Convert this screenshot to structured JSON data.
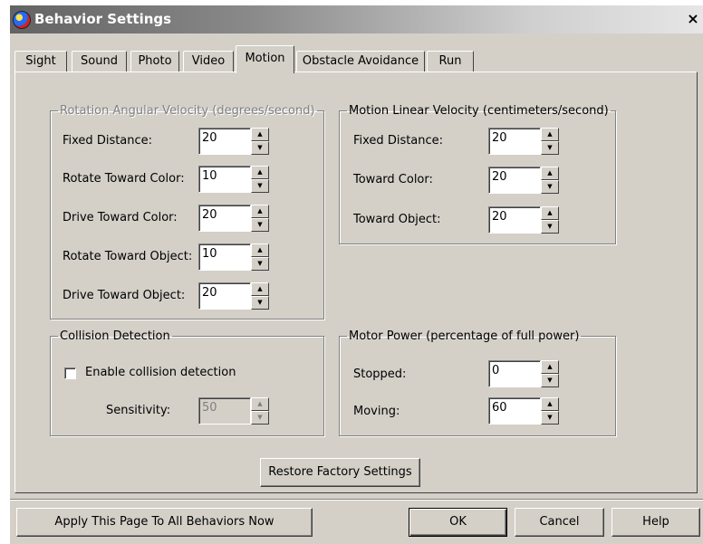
{
  "window": {
    "title": "Behavior Settings",
    "close_glyph": "×"
  },
  "tabs": [
    {
      "label": "Sight"
    },
    {
      "label": "Sound"
    },
    {
      "label": "Photo"
    },
    {
      "label": "Video"
    },
    {
      "label": "Motion",
      "active": true
    },
    {
      "label": "Obstacle Avoidance"
    },
    {
      "label": "Run"
    }
  ],
  "rotation_group": {
    "legend": "Rotation Angular Velocity (degrees/second)",
    "disabled": true,
    "fields": [
      {
        "label": "Fixed Distance:",
        "value": "20"
      },
      {
        "label": "Rotate Toward Color:",
        "value": "10"
      },
      {
        "label": "Drive Toward Color:",
        "value": "20"
      },
      {
        "label": "Rotate Toward Object:",
        "value": "10"
      },
      {
        "label": "Drive Toward Object:",
        "value": "20"
      }
    ]
  },
  "linear_group": {
    "legend": "Motion Linear Velocity (centimeters/second)",
    "fields": [
      {
        "label": "Fixed Distance:",
        "value": "20"
      },
      {
        "label": "Toward Color:",
        "value": "20"
      },
      {
        "label": "Toward Object:",
        "value": "20"
      }
    ]
  },
  "collision_group": {
    "legend": "Collision Detection",
    "checkbox_label": "Enable collision detection",
    "checked": false,
    "sensitivity_label": "Sensitivity:",
    "sensitivity_value": "50"
  },
  "motor_group": {
    "legend": "Motor Power (percentage of full power)",
    "fields": [
      {
        "label": "Stopped:",
        "value": "0"
      },
      {
        "label": "Moving:",
        "value": "60"
      }
    ]
  },
  "spinner_glyphs": {
    "up": "▲",
    "down": "▼"
  },
  "buttons": {
    "restore": "Restore Factory Settings",
    "apply_all": "Apply This Page To All Behaviors Now",
    "ok": "OK",
    "cancel": "Cancel",
    "help": "Help"
  }
}
